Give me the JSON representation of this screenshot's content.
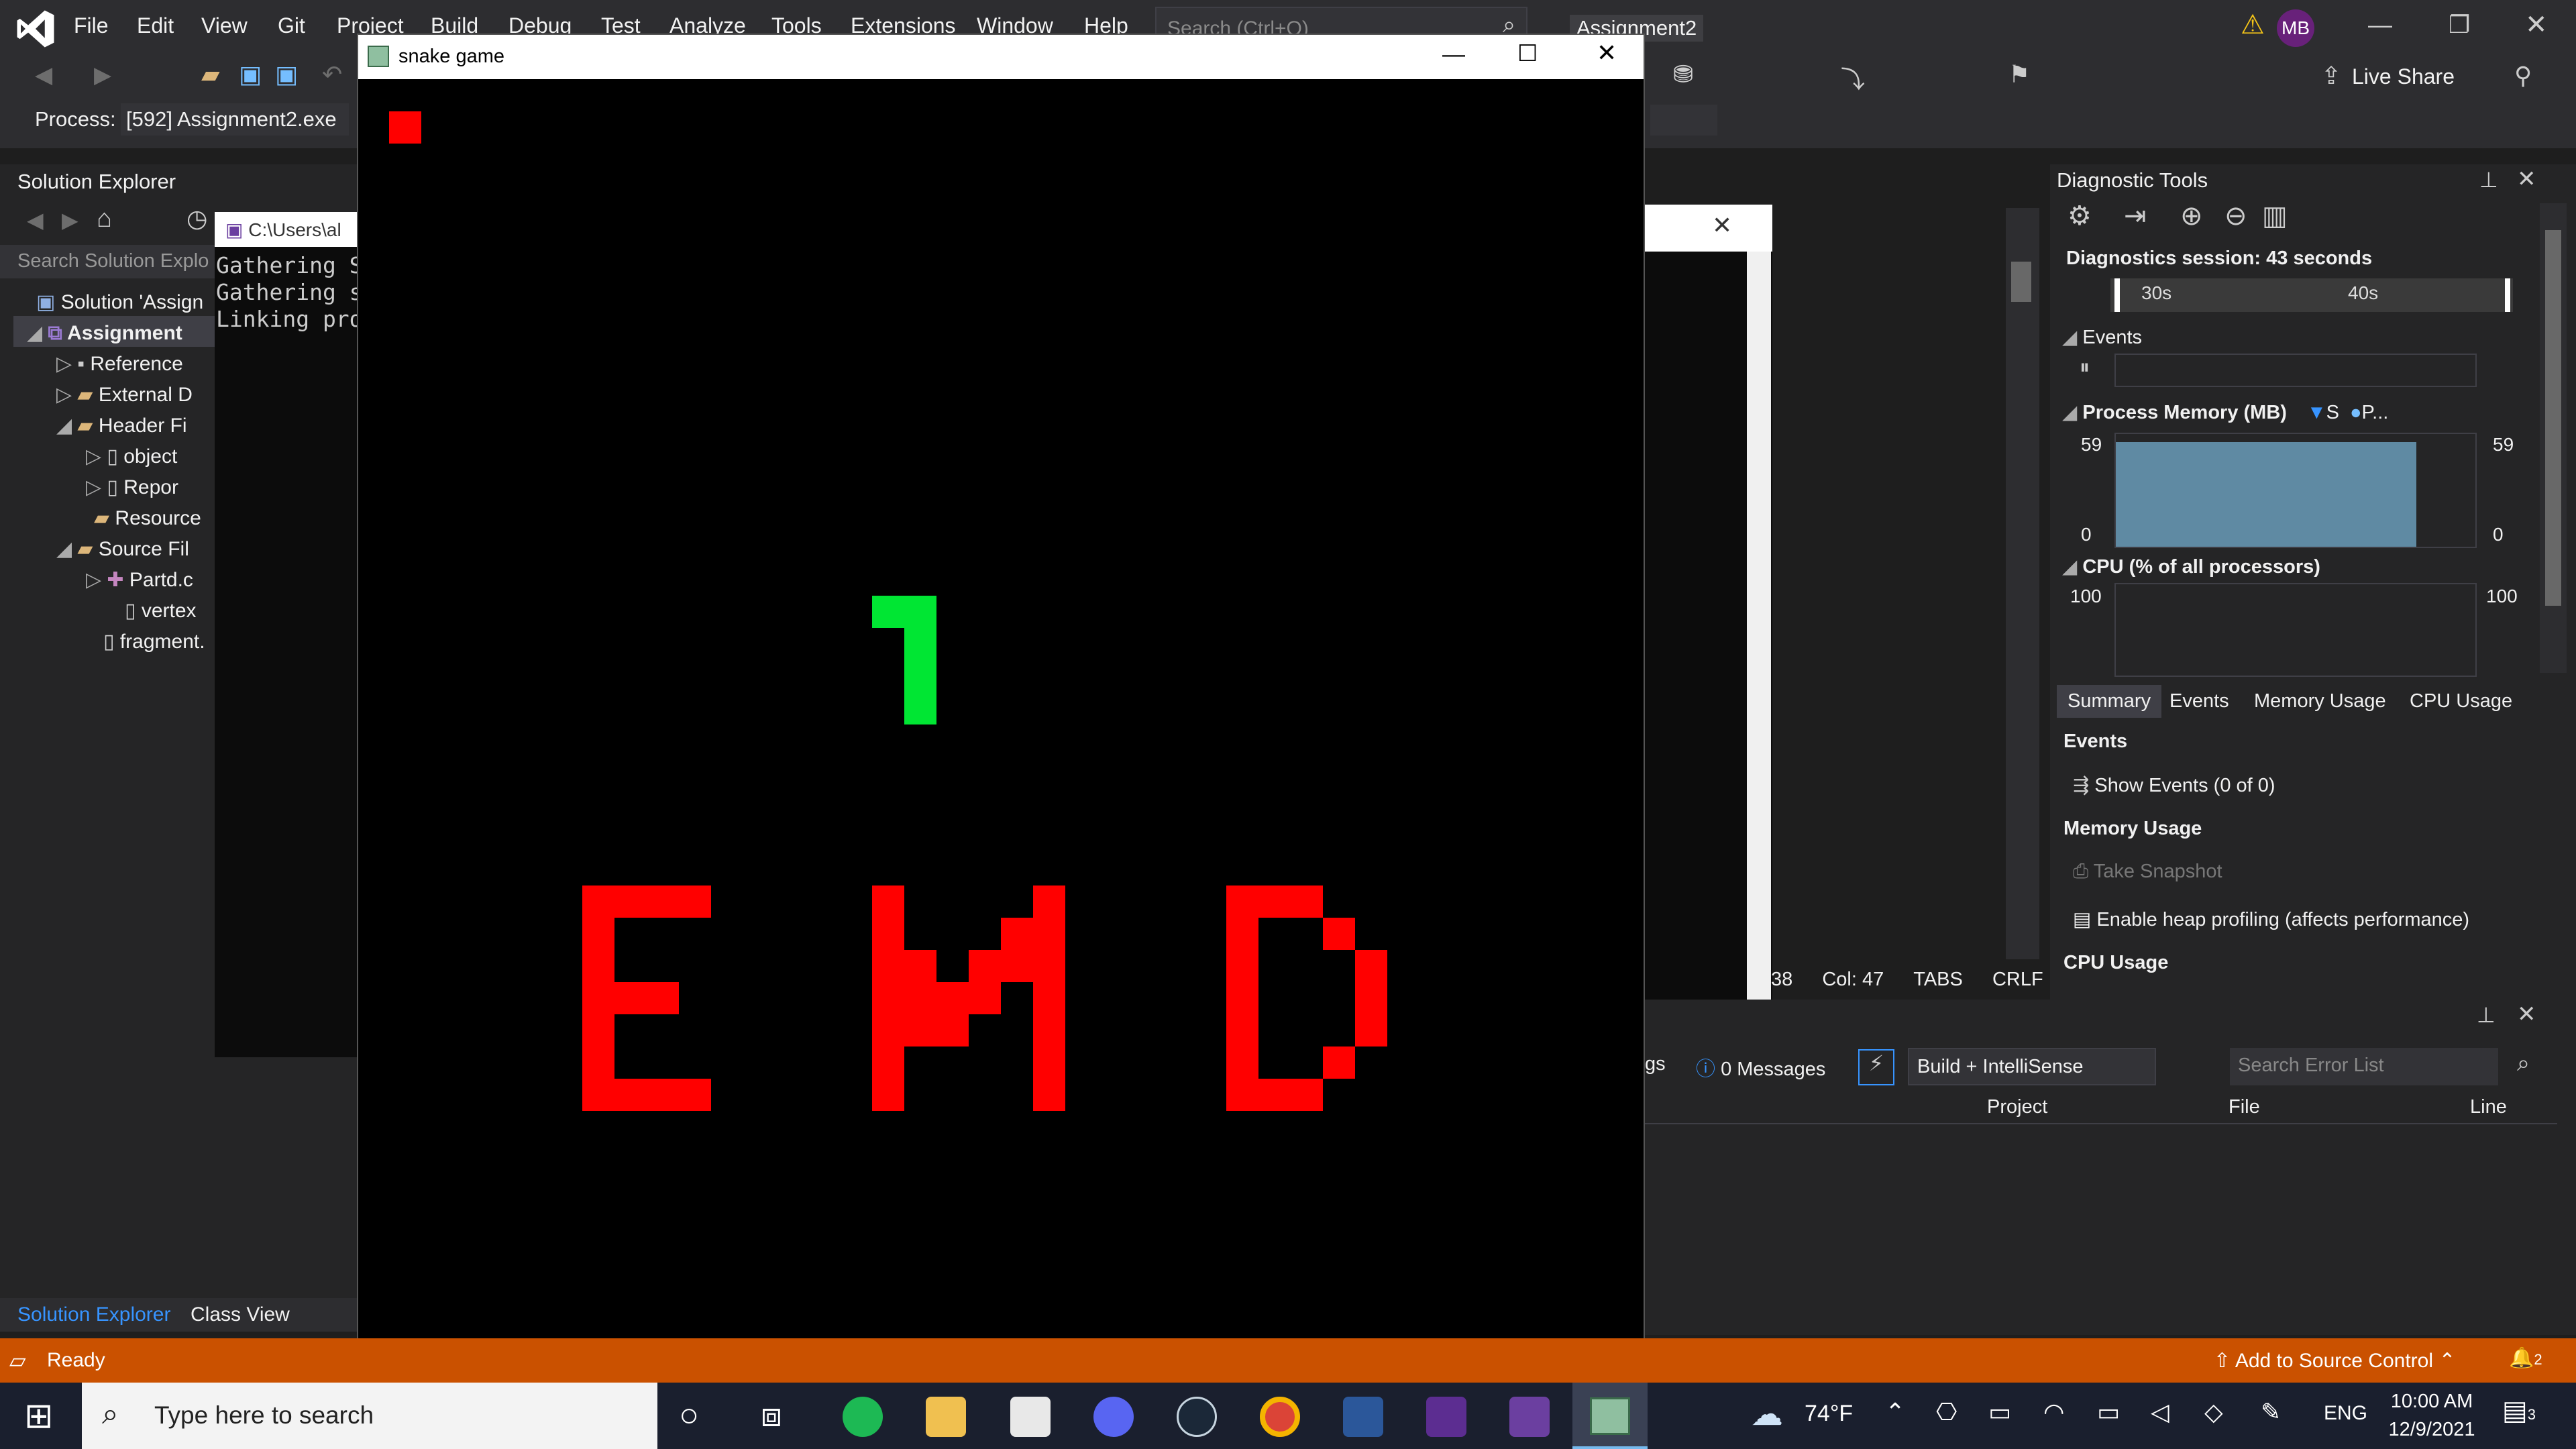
{
  "menubar": {
    "items": [
      "File",
      "Edit",
      "View",
      "Git",
      "Project",
      "Build",
      "Debug",
      "Test",
      "Analyze",
      "Tools",
      "Extensions",
      "Window",
      "Help"
    ],
    "search_placeholder": "Search (Ctrl+Q)",
    "solution_name": "Assignment2",
    "user_initials": "MB"
  },
  "toolbar": {
    "process_label": "Process:",
    "process_value": "[592] Assignment2.exe",
    "live_share": "Live Share"
  },
  "solution_explorer": {
    "title": "Solution Explorer",
    "search_placeholder": "Search Solution Explo",
    "items": [
      {
        "label": "Solution 'Assign"
      },
      {
        "label": "Assignment"
      },
      {
        "label": "Reference"
      },
      {
        "label": "External D"
      },
      {
        "label": "Header Fi"
      },
      {
        "label": "object"
      },
      {
        "label": "Repor"
      },
      {
        "label": "Resource"
      },
      {
        "label": "Source Fil"
      },
      {
        "label": "Partd.c"
      },
      {
        "label": "vertex"
      },
      {
        "label": "fragment."
      }
    ],
    "tab_solution": "Solution Explorer",
    "tab_class": "Class View"
  },
  "console": {
    "path": "C:\\Users\\al",
    "lines": [
      "Gathering S",
      "Gathering s",
      "Linking pro"
    ]
  },
  "snake_window": {
    "title": "snake game",
    "end_text": "END",
    "colors": {
      "food": "#ff0000",
      "snake": "#00e633",
      "end": "#ff0000",
      "background": "#000000"
    }
  },
  "diagnostics": {
    "title": "Diagnostic Tools",
    "session": "Diagnostics session: 43 seconds",
    "ticks": [
      "30s",
      "40s"
    ],
    "events_label": "Events",
    "memory_label": "Process Memory (MB)",
    "memory_legend": [
      "S",
      "P..."
    ],
    "memory_max_left": "59",
    "memory_max_right": "59",
    "memory_min_left": "0",
    "memory_min_right": "0",
    "cpu_label": "CPU (% of all processors)",
    "cpu_max_left": "100",
    "cpu_max_right": "100",
    "tabs": [
      "Summary",
      "Events",
      "Memory Usage",
      "CPU Usage"
    ],
    "summary": {
      "events_head": "Events",
      "show_events": "Show Events (0 of 0)",
      "memory_head": "Memory Usage",
      "take_snapshot": "Take Snapshot",
      "heap_profiling": "Enable heap profiling (affects performance)",
      "cpu_head": "CPU Usage"
    }
  },
  "editor_status": {
    "col": "Col: 47",
    "tabs": "TABS",
    "crlf": "CRLF",
    "line_frag": "38"
  },
  "error_list": {
    "messages": "0 Messages",
    "warnings_frag": "gs",
    "filter": "Build + IntelliSense",
    "search_placeholder": "Search Error List",
    "columns": [
      "Project",
      "File",
      "Line"
    ]
  },
  "statusbar": {
    "ready": "Ready",
    "source_control": "Add to Source Control",
    "notif_count": "2"
  },
  "taskbar": {
    "search_placeholder": "Type here to search",
    "weather": "74°F",
    "lang": "ENG",
    "time": "10:00 AM",
    "date": "12/9/2021",
    "notif_count": "3"
  }
}
